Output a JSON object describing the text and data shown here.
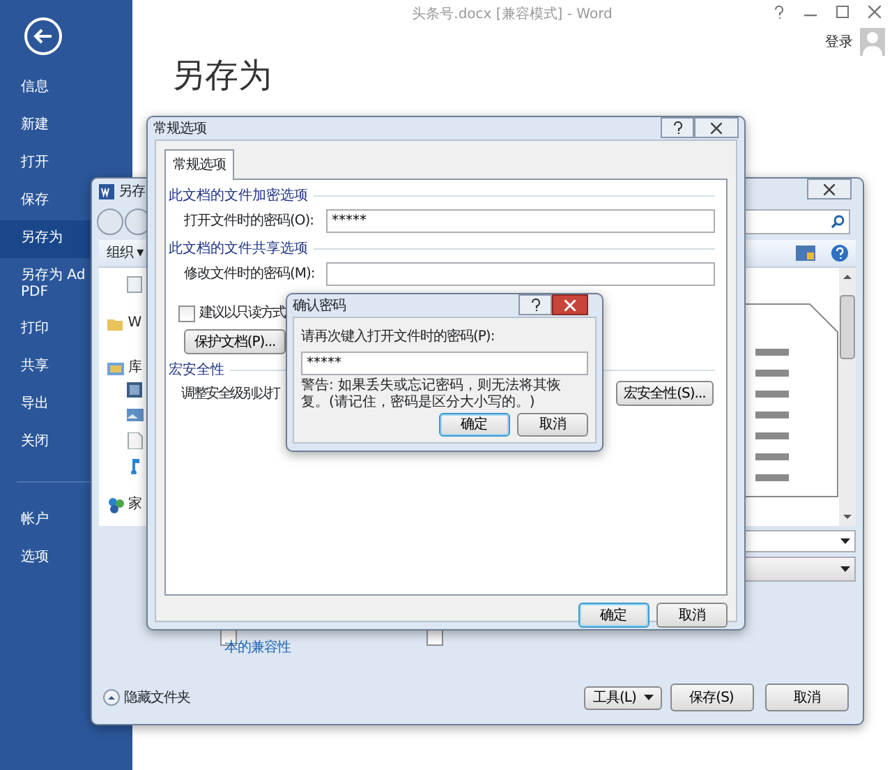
{
  "app_window": {
    "title": "头条号.docx [兼容模式] - Word",
    "sign_in": "登录",
    "heading": "另存为"
  },
  "sidebar": {
    "items": [
      {
        "label": "信息",
        "selected": false
      },
      {
        "label": "新建",
        "selected": false
      },
      {
        "label": "打开",
        "selected": false
      },
      {
        "label": "保存",
        "selected": false
      },
      {
        "label": "另存为",
        "selected": true
      },
      {
        "label": "另存为 Ad\nPDF",
        "selected": false
      },
      {
        "label": "打印",
        "selected": false
      },
      {
        "label": "共享",
        "selected": false
      },
      {
        "label": "导出",
        "selected": false
      },
      {
        "label": "关闭",
        "selected": false
      }
    ],
    "bottom_items": [
      {
        "label": "帐户",
        "selected": false
      },
      {
        "label": "选项",
        "selected": false
      }
    ]
  },
  "save_dialog": {
    "title": "另存",
    "organize": "组织 ▾",
    "nav_items": [
      {
        "label": "W",
        "kind": "folder"
      },
      {
        "label": "库",
        "kind": "library"
      },
      {
        "label": "家",
        "kind": "homegroup"
      }
    ],
    "options": [
      {
        "checked": false
      },
      {
        "checked": false
      }
    ],
    "compat_link": "本的兼容性",
    "hide_folders": "隐藏文件夹",
    "buttons": [
      {
        "label": "工具(L)",
        "kind": "dropdown"
      },
      {
        "label": "保存(S)",
        "kind": "button"
      },
      {
        "label": "取消",
        "kind": "button"
      }
    ]
  },
  "general_options": {
    "title": "常规选项",
    "tabs": [
      {
        "label": "常规选项",
        "selected": true
      }
    ],
    "encryption_group": "此文档的文件加密选项",
    "open_password": {
      "label": "打开文件时的密码(O):",
      "value": "*****"
    },
    "sharing_group": "此文档的文件共享选项",
    "modify_password": {
      "label": "修改文件时的密码(M):"
    },
    "read_only": {
      "label": "建议以只读方式",
      "checked": false
    },
    "protect_button": "保护文档(P)...",
    "macro_group": "宏安全性",
    "macro_text": "调整安全级别以打",
    "macro_button": "宏安全性(S)...",
    "buttons": [
      {
        "label": "确定",
        "default": true
      },
      {
        "label": "取消",
        "default": false
      }
    ]
  },
  "confirm_dialog": {
    "title": "确认密码",
    "prompt": "请再次键入打开文件时的密码(P):",
    "value": "*****",
    "warning": "警告: 如果丢失或忘记密码，则无法将其恢复。(请记住，密码是区分大小写的。)",
    "buttons": [
      {
        "label": "确定",
        "default": true
      },
      {
        "label": "取消",
        "default": false
      }
    ]
  }
}
